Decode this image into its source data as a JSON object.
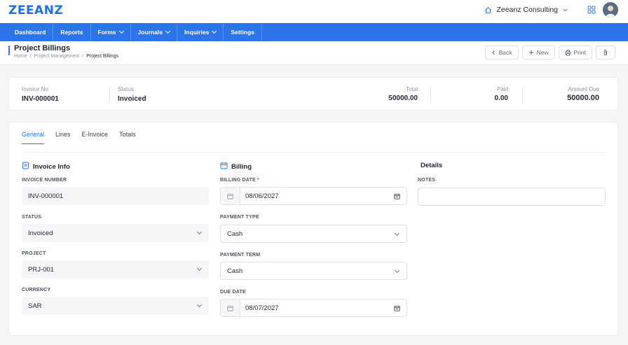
{
  "app": {
    "logo": "ZEEANZ",
    "company": "Zeeanz Consulting"
  },
  "nav": [
    {
      "label": "Dashboard",
      "dropdown": false
    },
    {
      "label": "Reports",
      "dropdown": false
    },
    {
      "label": "Forms",
      "dropdown": true
    },
    {
      "label": "Journals",
      "dropdown": true
    },
    {
      "label": "Inquiries",
      "dropdown": true
    },
    {
      "label": "Settings",
      "dropdown": false
    }
  ],
  "page": {
    "title": "Project Billings",
    "breadcrumb": [
      "Home",
      "Project Management",
      "Project Billings"
    ],
    "actions": {
      "back": "Back",
      "new": "New",
      "print": "Print"
    }
  },
  "summary": {
    "invoice_no_label": "Invoice No",
    "invoice_no": "INV-000001",
    "status_label": "Status",
    "status": "Invoiced",
    "total_label": "Total",
    "total": "50000.00",
    "paid_label": "Paid",
    "paid": "0.00",
    "due_label": "Amount Due",
    "due": "50000.00"
  },
  "tabs": [
    "General",
    "Lines",
    "E-Invoice",
    "Totals"
  ],
  "invoice_info": {
    "title": "Invoice Info",
    "invoice_number_label": "INVOICE NUMBER",
    "invoice_number": "INV-000001",
    "status_label": "STATUS",
    "status": "Invoiced",
    "project_label": "PROJECT",
    "project": "PRJ-001",
    "currency_label": "CURRENCY",
    "currency": "SAR"
  },
  "billing": {
    "title": "Billing",
    "billing_date_label": "BILLING DATE",
    "required_mark": "*",
    "billing_date": "08/06/2027",
    "payment_type_label": "PAYMENT TYPE",
    "payment_type": "Cash",
    "payment_term_label": "PAYMENT TERM",
    "payment_term": "Cash",
    "due_date_label": "DUE DATE",
    "due_date": "08/07/2027"
  },
  "details": {
    "title": "Details",
    "notes_label": "NOTES",
    "notes": ""
  },
  "colors": {
    "brand": "#2b74ea",
    "logo": "#1e6fe6",
    "required": "#e53935"
  }
}
